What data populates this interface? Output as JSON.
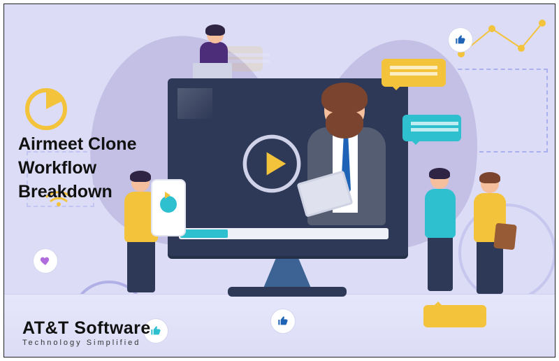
{
  "headline": {
    "line1": "Airmeet Clone",
    "line2": "Workflow",
    "line3": "Breakdown"
  },
  "brand": {
    "name": "AT&T Software",
    "tagline": "Technology Simplified"
  },
  "colors": {
    "bg": "#dcdcf6",
    "accent_yellow": "#f3c33c",
    "accent_teal": "#2fc0cf",
    "monitor": "#2e3957",
    "presenter_suit": "#555d72",
    "presenter_tie": "#1e63b6",
    "presenter_hair": "#7a442f",
    "purple_shirt": "#4c2d7a"
  },
  "icons": {
    "play_main": "play-icon",
    "phone_play": "play-icon",
    "thumbs_up": "thumbs-up-icon",
    "heart": "heart-icon",
    "wifi": "wifi-icon",
    "pie": "pie-chart-icon",
    "gear": "gear-icon",
    "speech": "speech-bubble-icon"
  }
}
